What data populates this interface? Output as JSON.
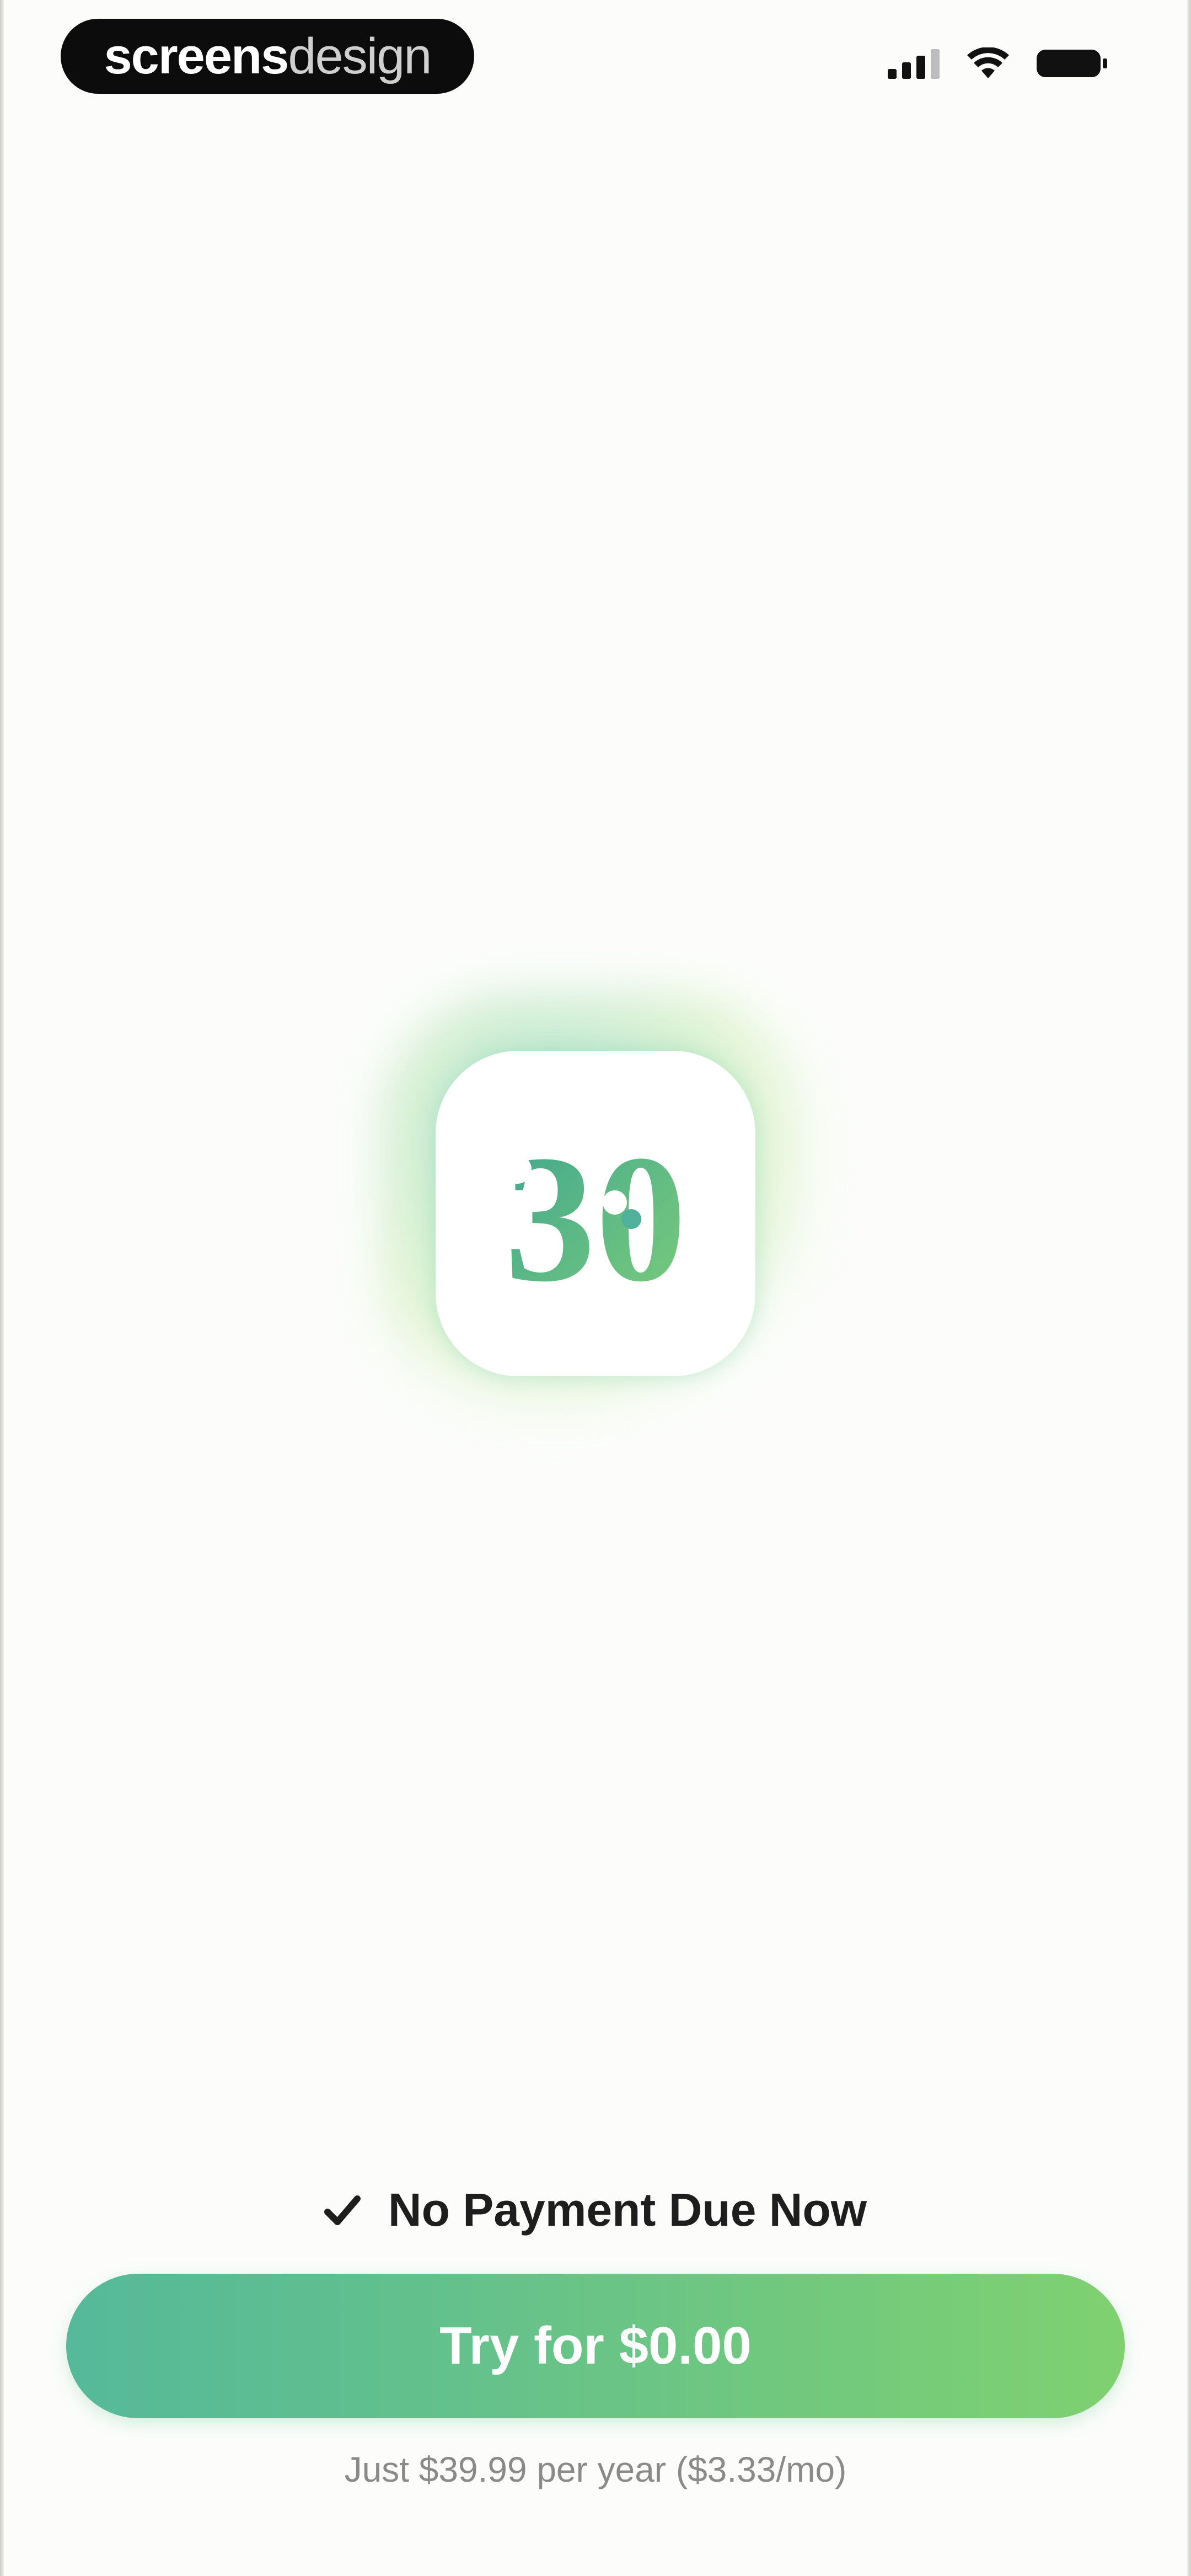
{
  "brand": {
    "bold": "screens",
    "light": "design"
  },
  "status_bar": {
    "icons": [
      "cellular-signal-icon",
      "wifi-icon",
      "battery-icon"
    ]
  },
  "app_icon": {
    "name": "app-logo-30-icon",
    "glyph": "30",
    "colors": {
      "start": "#4fb19b",
      "end": "#7ccd7a"
    }
  },
  "paywall": {
    "check_icon": "checkmark-icon",
    "no_payment_label": "No Payment Due Now",
    "cta_label": "Try for $0.00",
    "price_note": "Just $39.99 per year ($3.33/mo)"
  },
  "colors": {
    "background": "#fcfdfb",
    "accent_start": "#55b99a",
    "accent_end": "#7fd170",
    "text_dark": "#1e1e1e",
    "text_muted": "#8a8a8a"
  }
}
